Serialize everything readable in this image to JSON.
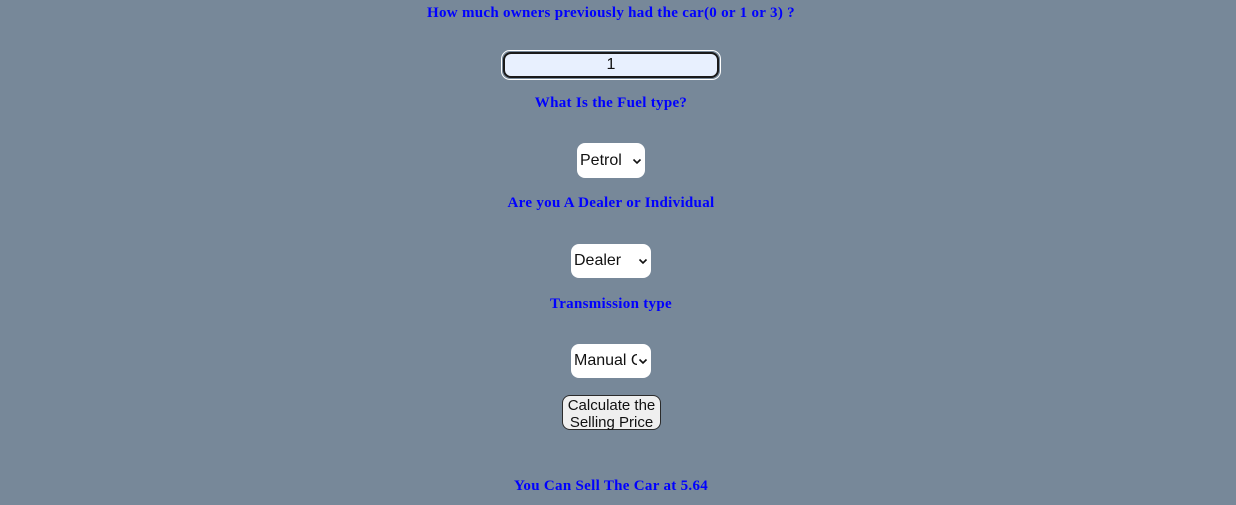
{
  "form": {
    "owners_question": "How much owners previously had the car(0 or 1 or 3) ?",
    "owners_value": "1",
    "fuel_question": "What Is the Fuel type?",
    "fuel_selected": "Petrol",
    "seller_question": "Are you A Dealer or Individual",
    "seller_selected": "Dealer",
    "transmission_question": "Transmission type",
    "transmission_selected": "Manual C",
    "submit_label": "Calculate the Selling Price"
  },
  "result": {
    "text": "You Can Sell The Car at 5.64"
  },
  "colors": {
    "background": "#778899",
    "label_text": "#0000ff",
    "input_background": "#e8f0fe",
    "select_background": "#ffffff",
    "button_background": "#efefef"
  },
  "icons": {
    "dropdown": "chevron-down-icon"
  }
}
